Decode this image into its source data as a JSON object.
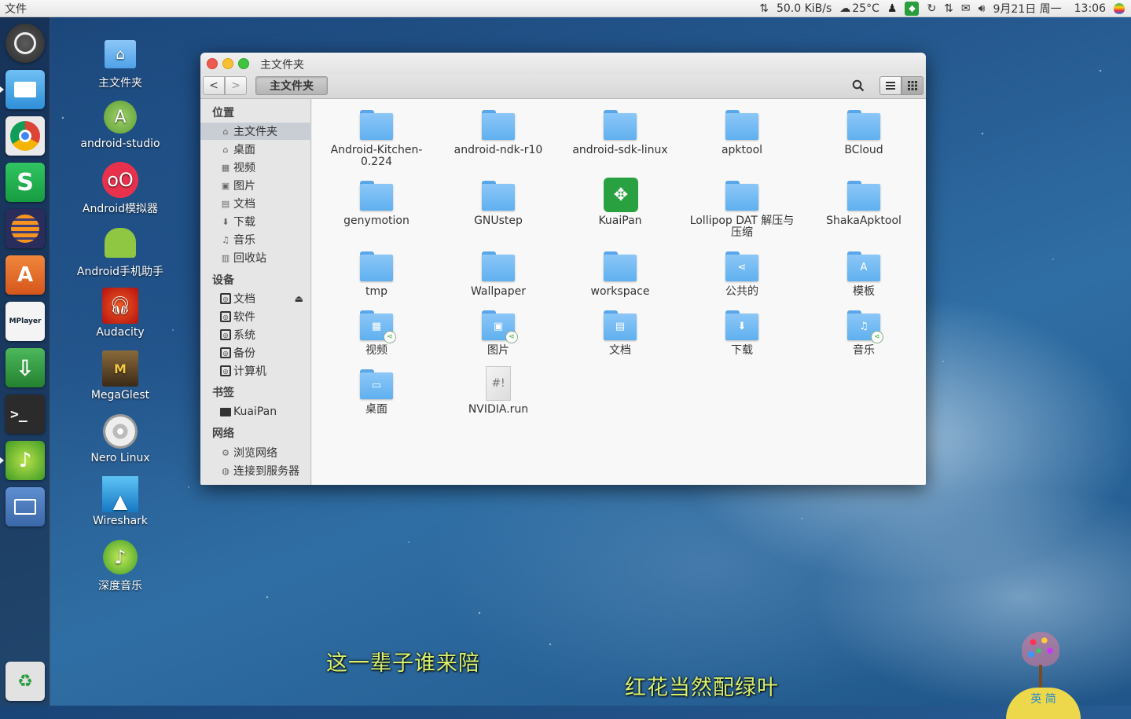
{
  "topbar": {
    "app_name": "文件",
    "net_speed": "50.0 KiB/s",
    "weather": "25°C",
    "date": "9月21日 周一",
    "time": "13:06"
  },
  "launcher": {
    "items": [
      {
        "name": "ubuntu-logo-icon",
        "color": "#3a3a3a"
      },
      {
        "name": "files-icon",
        "color": "#2f8fd8"
      },
      {
        "name": "chrome-icon",
        "color": "#e8e8e8"
      },
      {
        "name": "wps-spreadsheet-icon",
        "color": "#1fb04a"
      },
      {
        "name": "eclipse-icon",
        "color": "#2c2f6e"
      },
      {
        "name": "software-center-icon",
        "color": "#e86a2a"
      },
      {
        "name": "mplayer-icon",
        "color": "#f2f2f2"
      },
      {
        "name": "download-manager-icon",
        "color": "#2f9c42"
      },
      {
        "name": "terminal-icon",
        "color": "#2d2d2d"
      },
      {
        "name": "deepin-music-icon",
        "color": "#3c9a2e"
      },
      {
        "name": "workspace-switcher-icon",
        "color": "#4a78b8"
      },
      {
        "name": "trash-icon",
        "color": "#d8d8d8"
      }
    ]
  },
  "desktop_icons": [
    {
      "label": "主文件夹",
      "icon": "home-folder-icon"
    },
    {
      "label": "android-studio",
      "icon": "android-studio-icon"
    },
    {
      "label": "Android模拟器",
      "icon": "android-emulator-icon"
    },
    {
      "label": "Android手机助手",
      "icon": "android-assistant-icon"
    },
    {
      "label": "Audacity",
      "icon": "audacity-icon"
    },
    {
      "label": "MegaGlest",
      "icon": "megaglest-icon"
    },
    {
      "label": "Nero Linux",
      "icon": "nero-icon"
    },
    {
      "label": "Wireshark",
      "icon": "wireshark-icon"
    },
    {
      "label": "深度音乐",
      "icon": "deepin-music-icon"
    }
  ],
  "window": {
    "title": "主文件夹",
    "breadcrumb": "主文件夹",
    "sidebar": {
      "sections": [
        {
          "title": "位置",
          "items": [
            {
              "label": "主文件夹",
              "icon": "home-icon",
              "selected": true
            },
            {
              "label": "桌面",
              "icon": "desktop-icon"
            },
            {
              "label": "视频",
              "icon": "video-icon"
            },
            {
              "label": "图片",
              "icon": "picture-icon"
            },
            {
              "label": "文档",
              "icon": "document-icon"
            },
            {
              "label": "下载",
              "icon": "download-icon"
            },
            {
              "label": "音乐",
              "icon": "music-icon"
            },
            {
              "label": "回收站",
              "icon": "trash-icon"
            }
          ]
        },
        {
          "title": "设备",
          "items": [
            {
              "label": "文档",
              "icon": "drive-icon",
              "eject": true
            },
            {
              "label": "软件",
              "icon": "drive-icon"
            },
            {
              "label": "系统",
              "icon": "drive-icon"
            },
            {
              "label": "备份",
              "icon": "drive-icon"
            },
            {
              "label": "计算机",
              "icon": "drive-icon"
            }
          ]
        },
        {
          "title": "书签",
          "items": [
            {
              "label": "KuaiPan",
              "icon": "folder-icon"
            }
          ]
        },
        {
          "title": "网络",
          "items": [
            {
              "label": "浏览网络",
              "icon": "network-icon"
            },
            {
              "label": "连接到服务器",
              "icon": "server-icon"
            }
          ]
        }
      ]
    },
    "files": [
      {
        "name": "Android-Kitchen-0.224",
        "type": "folder"
      },
      {
        "name": "android-ndk-r10",
        "type": "folder"
      },
      {
        "name": "android-sdk-linux",
        "type": "folder"
      },
      {
        "name": "apktool",
        "type": "folder"
      },
      {
        "name": "BCloud",
        "type": "folder"
      },
      {
        "name": "genymotion",
        "type": "folder"
      },
      {
        "name": "GNUstep",
        "type": "folder"
      },
      {
        "name": "KuaiPan",
        "type": "kuaipan"
      },
      {
        "name": "Lollipop DAT 解压与压缩",
        "type": "folder"
      },
      {
        "name": "ShakaApktool",
        "type": "folder"
      },
      {
        "name": "tmp",
        "type": "folder"
      },
      {
        "name": "Wallpaper",
        "type": "folder"
      },
      {
        "name": "workspace",
        "type": "folder"
      },
      {
        "name": "公共的",
        "type": "folder",
        "emblem": "share-emblem-icon"
      },
      {
        "name": "模板",
        "type": "folder",
        "emblem": "template-emblem-icon"
      },
      {
        "name": "视频",
        "type": "folder",
        "emblem": "video-emblem-icon",
        "shared": true
      },
      {
        "name": "图片",
        "type": "folder",
        "emblem": "picture-emblem-icon",
        "shared": true
      },
      {
        "name": "文档",
        "type": "folder",
        "emblem": "document-emblem-icon"
      },
      {
        "name": "下载",
        "type": "folder",
        "emblem": "download-emblem-icon"
      },
      {
        "name": "音乐",
        "type": "folder",
        "emblem": "music-emblem-icon",
        "shared": true
      },
      {
        "name": "桌面",
        "type": "folder",
        "emblem": "desktop-emblem-icon"
      },
      {
        "name": "NVIDIA.run",
        "type": "script"
      }
    ]
  },
  "subtitles": {
    "line1": "这一辈子谁来陪",
    "line2": "红花当然配绿叶"
  },
  "ime": {
    "label": "英 简"
  }
}
